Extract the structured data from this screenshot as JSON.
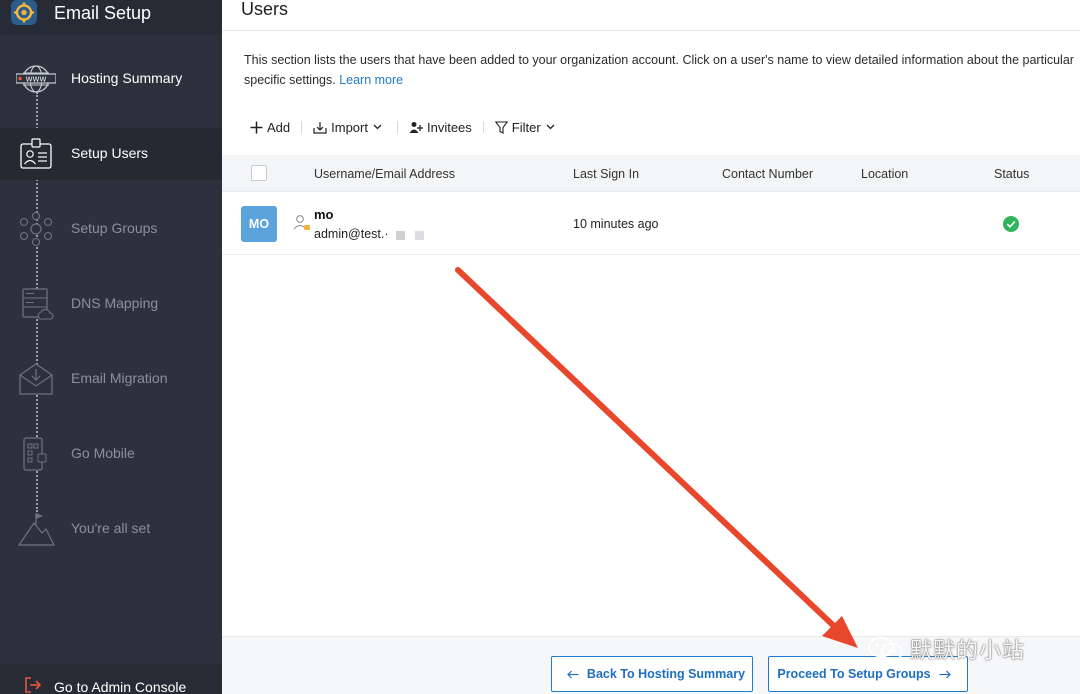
{
  "app": {
    "title": "Email Setup",
    "footer_link": "Go to Admin Console"
  },
  "sidebar": {
    "items": [
      {
        "label": "Hosting Summary",
        "icon": "globe-www-icon",
        "state": "done"
      },
      {
        "label": "Setup Users",
        "icon": "id-card-icon",
        "state": "active"
      },
      {
        "label": "Setup Groups",
        "icon": "group-network-icon",
        "state": "pending"
      },
      {
        "label": "DNS Mapping",
        "icon": "server-cloud-icon",
        "state": "pending"
      },
      {
        "label": "Email Migration",
        "icon": "envelope-download-icon",
        "state": "pending"
      },
      {
        "label": "Go Mobile",
        "icon": "mobile-apps-icon",
        "state": "pending"
      },
      {
        "label": "You're all set",
        "icon": "mountain-flag-icon",
        "state": "pending"
      }
    ]
  },
  "main": {
    "title": "Users",
    "description_line1": "This section lists the users that have been added to your organization account. Click on a user's name to view detailed information about the particular",
    "description_line2": "specific settings.",
    "learn_more": "Learn more",
    "toolbar": {
      "add": "Add",
      "import": "Import",
      "invitees": "Invitees",
      "filter": "Filter"
    },
    "table": {
      "columns": [
        "Username/Email Address",
        "Last Sign In",
        "Contact Number",
        "Location",
        "Status"
      ],
      "rows": [
        {
          "initials": "MO",
          "name": "mo",
          "email": "admin@test.·",
          "last_sign_in": "10 minutes ago",
          "contact": "",
          "location": "",
          "status": "active"
        }
      ]
    },
    "buttons": {
      "back": "Back To Hosting Summary",
      "proceed": "Proceed To Setup Groups"
    }
  },
  "watermark": "默默的小站",
  "colors": {
    "sidebar_bg": "#2c323d",
    "accent": "#1f7ad0",
    "avatar": "#5ba3dc",
    "status_ok": "#2eb55b",
    "annotation_arrow": "#e8472c"
  }
}
